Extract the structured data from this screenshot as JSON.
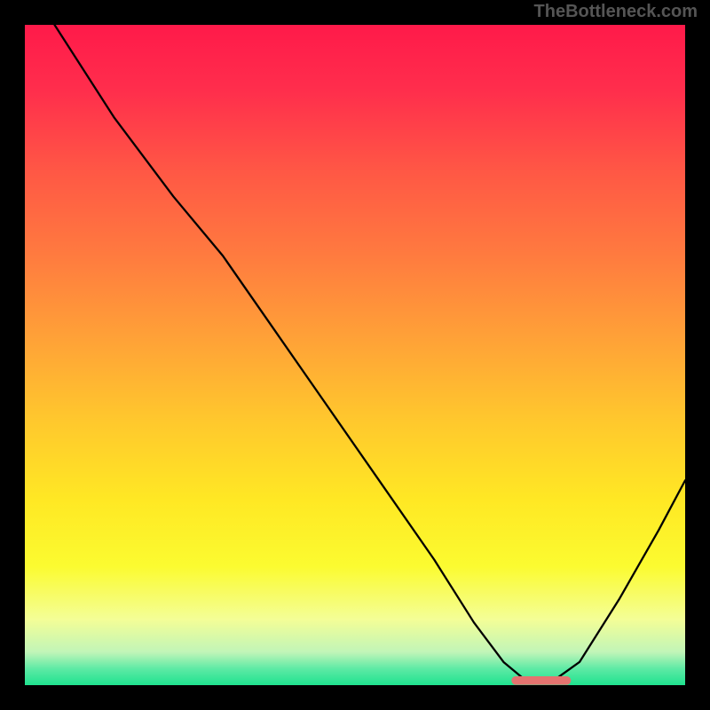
{
  "watermark": "TheBottleneck.com",
  "chart_data": {
    "type": "line",
    "title": "",
    "xlabel": "",
    "ylabel": "",
    "xlim": [
      0,
      100
    ],
    "ylim": [
      0,
      100
    ],
    "background_gradient_stops": [
      {
        "pos": 0.0,
        "color": "#ff1a4a"
      },
      {
        "pos": 0.1,
        "color": "#ff2e4c"
      },
      {
        "pos": 0.22,
        "color": "#ff5745"
      },
      {
        "pos": 0.35,
        "color": "#ff7b3f"
      },
      {
        "pos": 0.48,
        "color": "#ffa337"
      },
      {
        "pos": 0.6,
        "color": "#ffc82d"
      },
      {
        "pos": 0.72,
        "color": "#ffe824"
      },
      {
        "pos": 0.82,
        "color": "#fbfb30"
      },
      {
        "pos": 0.9,
        "color": "#f4fe96"
      },
      {
        "pos": 0.95,
        "color": "#c1f5b8"
      },
      {
        "pos": 0.975,
        "color": "#5eeaa5"
      },
      {
        "pos": 1.0,
        "color": "#1fe28f"
      }
    ],
    "series": [
      {
        "name": "bottleneck-curve",
        "color": "#000000",
        "width": 2.3,
        "points": [
          {
            "x": 4.5,
            "y": 100.0
          },
          {
            "x": 13.5,
            "y": 86.0
          },
          {
            "x": 22.5,
            "y": 74.0
          },
          {
            "x": 30.0,
            "y": 65.0
          },
          {
            "x": 38.0,
            "y": 53.5
          },
          {
            "x": 46.0,
            "y": 42.0
          },
          {
            "x": 54.0,
            "y": 30.5
          },
          {
            "x": 62.0,
            "y": 19.0
          },
          {
            "x": 68.0,
            "y": 9.5
          },
          {
            "x": 72.5,
            "y": 3.5
          },
          {
            "x": 75.5,
            "y": 1.0
          },
          {
            "x": 80.5,
            "y": 1.0
          },
          {
            "x": 84.0,
            "y": 3.5
          },
          {
            "x": 90.0,
            "y": 13.0
          },
          {
            "x": 96.0,
            "y": 23.5
          },
          {
            "x": 100.0,
            "y": 31.0
          }
        ]
      }
    ],
    "marker": {
      "name": "target-range",
      "shape": "rounded-rect",
      "color": "#e4736f",
      "x_center": 78.2,
      "y_center": 0.7,
      "width": 9.0,
      "height": 1.3,
      "rx": 0.65
    }
  }
}
